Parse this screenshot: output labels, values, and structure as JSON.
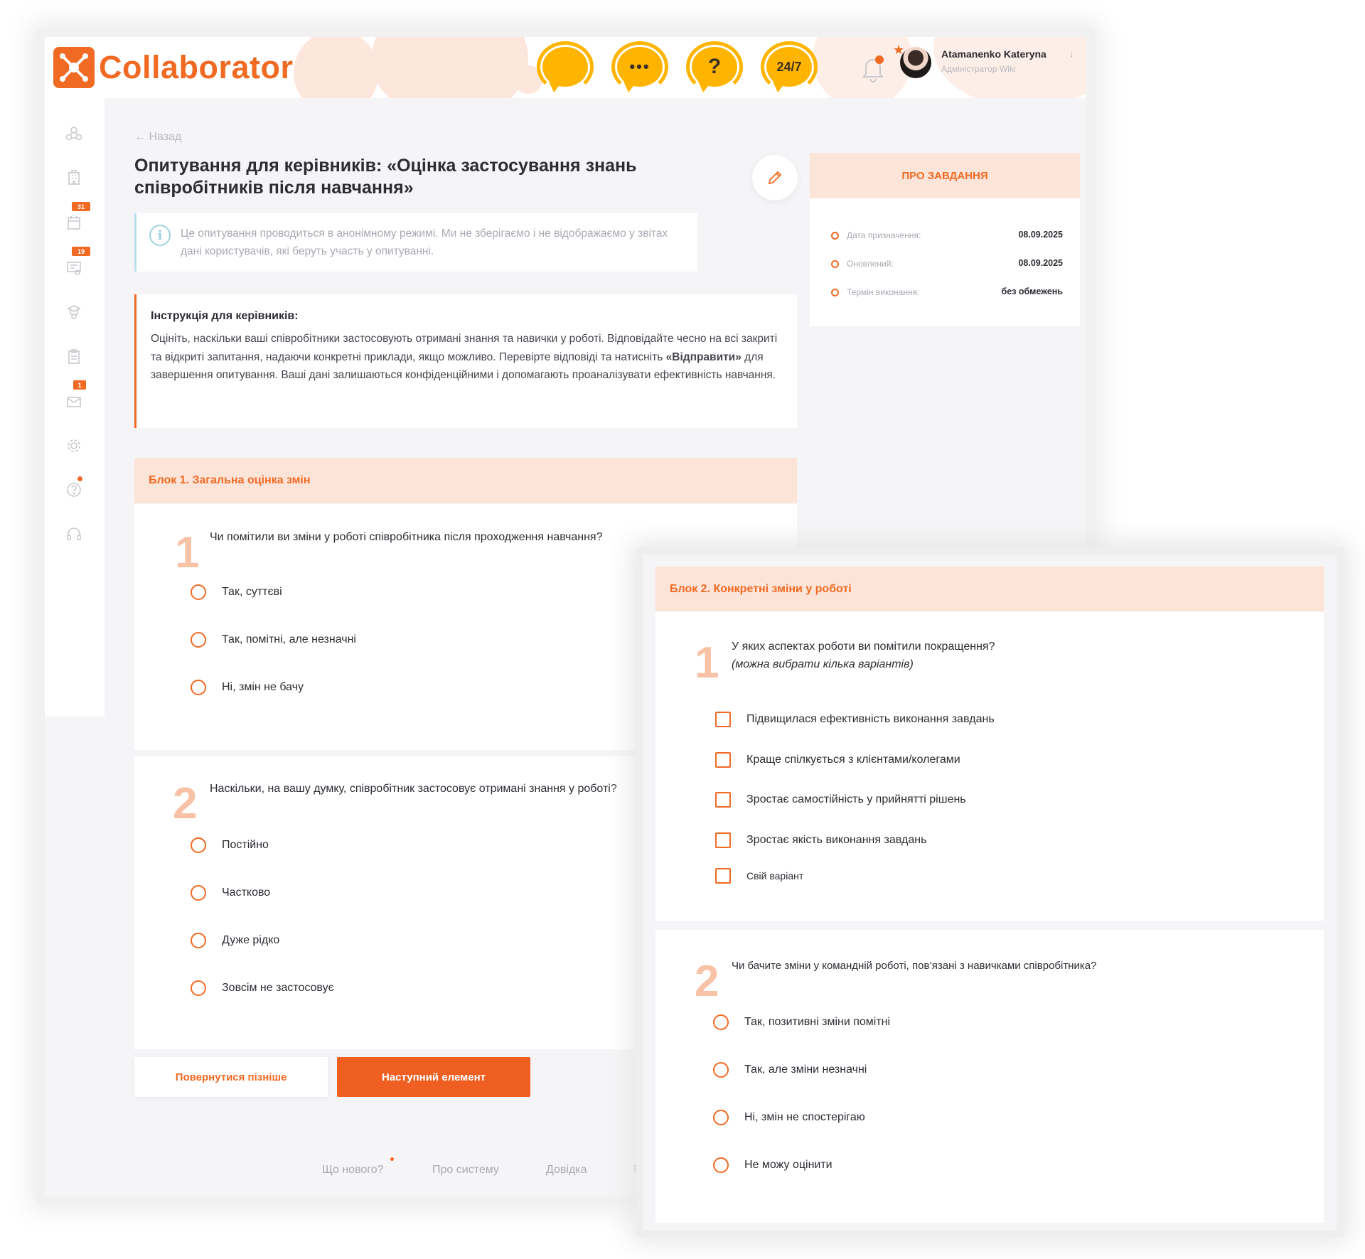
{
  "header": {
    "logo_text": "Collaborator",
    "support_icons": [
      {
        "name": "chat-headset-icon",
        "label": ""
      },
      {
        "name": "dots-chat-headset-icon",
        "label": "•••"
      },
      {
        "name": "question-headset-icon",
        "label": "?"
      },
      {
        "name": "support-247-icon",
        "label": "24/7"
      }
    ],
    "user_name": "Atamanenko Kateryna",
    "user_role": "Адміністратор Wiki",
    "accent_color": "#f06a23",
    "support_color": "#ffb400"
  },
  "sidebar": {
    "items": [
      {
        "icon": "network-icon",
        "badge": ""
      },
      {
        "icon": "building-icon",
        "badge": ""
      },
      {
        "icon": "calendar-icon",
        "badge": "31"
      },
      {
        "icon": "courses-icon",
        "badge": "19"
      },
      {
        "icon": "mentor-icon",
        "badge": ""
      },
      {
        "icon": "clipboard-icon",
        "badge": ""
      },
      {
        "icon": "inbox-icon",
        "badge": "1"
      },
      {
        "icon": "settings-icon",
        "badge": ""
      },
      {
        "icon": "help-icon",
        "badge": ""
      },
      {
        "icon": "support-icon",
        "badge": ""
      }
    ]
  },
  "page": {
    "back_label": "← Назад",
    "title": "Опитування для керівників: «Оцінка застосування знань співробітників після навчання»",
    "notice": "Це опитування проводиться в анонімному режимі. Ми не зберігаємо і не відображаємо у звітах дані користувачів, які беруть участь у опитуванні.",
    "instruction_title": "Інструкція для керівників:",
    "instruction_part1": "Оцініть, наскільки ваші співробітники застосовують отримані знання та навички у роботі. Відповідайте чесно на всі закриті та відкриті запитання, надаючи конкретні приклади, якщо можливо. Перевірте відповіді та натисніть ",
    "instruction_bold": "«Відправити»",
    "instruction_part2": " для завершення опитування. Ваші дані залишаються конфіденційними і допомагають проаналізувати ефективність навчання."
  },
  "task_info": {
    "title": "ПРО ЗАВДАННЯ",
    "rows": [
      {
        "label": "Дата призначення:",
        "value": "08.09.2025"
      },
      {
        "label": "Оновлений:",
        "value": "08.09.2025"
      },
      {
        "label": "Термін виконання:",
        "value": "без обмежень"
      }
    ]
  },
  "block1": {
    "title": "Блок 1. Загальна оцінка змін",
    "q1": {
      "number": "1",
      "text": "Чи помітили ви зміни у роботі співробітника після проходження навчання?",
      "options": [
        "Так, суттєві",
        "Так, помітні, але незначні",
        "Ні, змін не бачу"
      ]
    },
    "q2": {
      "number": "2",
      "text": "Наскільки, на вашу думку, співробітник застосовує отримані знання у роботі?",
      "options": [
        "Постійно",
        "Частково",
        "Дуже рідко",
        "Зовсім не застосовує"
      ]
    }
  },
  "buttons": {
    "later": "Повернутися пізніше",
    "next": "Наступний елемент"
  },
  "footer": {
    "links": [
      "Що нового?",
      "Про систему",
      "Довідка",
      "Р"
    ]
  },
  "block2": {
    "title": "Блок 2. Конкретні зміни у роботі",
    "q1": {
      "number": "1",
      "text": "У яких аспектах роботи ви помітили покращення?",
      "hint": "(можна вибрати кілька варіантів)",
      "options": [
        "Підвищилася ефективність виконання завдань",
        "Краще спілкується з клієнтами/колегами",
        "Зростає самостійність у прийнятті рішень",
        "Зростає якість виконання завдань",
        "Свій варіант"
      ]
    },
    "q2": {
      "number": "2",
      "text": "Чи бачите зміни у командній роботі, пов’язані з навичками співробітника?",
      "options": [
        "Так, позитивні зміни помітні",
        "Так, але зміни незначні",
        "Ні, змін не спостерігаю",
        "Не можу оцінити"
      ]
    }
  }
}
